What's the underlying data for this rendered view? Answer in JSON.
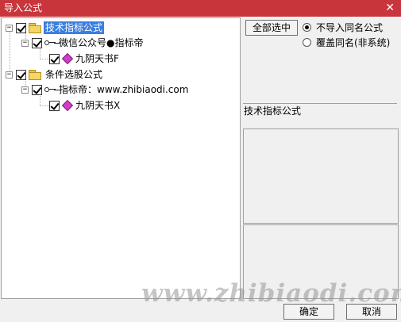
{
  "window": {
    "title": "导入公式",
    "close_symbol": "✕"
  },
  "tree": {
    "nodes": [
      {
        "label": "技术指标公式"
      },
      {
        "label": "微信公众号●指标帝"
      },
      {
        "label": "九阴天书F"
      },
      {
        "label": "条件选股公式"
      },
      {
        "label": "指标帝：www.zhibiaodi.com"
      },
      {
        "label": "九阴天书X"
      }
    ],
    "expander_symbol": "−"
  },
  "options": {
    "select_all_label": "全部选中",
    "radio_no_import": "不导入同名公式",
    "radio_overwrite": "覆盖同名(非系统)"
  },
  "info": {
    "formula_type": "技术指标公式"
  },
  "footer": {
    "ok_label": "确定",
    "cancel_label": "取消"
  },
  "watermark": "www.zhibiaodi.com",
  "colors": {
    "titlebar": "#c8353b",
    "selection": "#3a7ee0",
    "formula_icon": "#d23cc8",
    "folder": "#f5d565"
  }
}
